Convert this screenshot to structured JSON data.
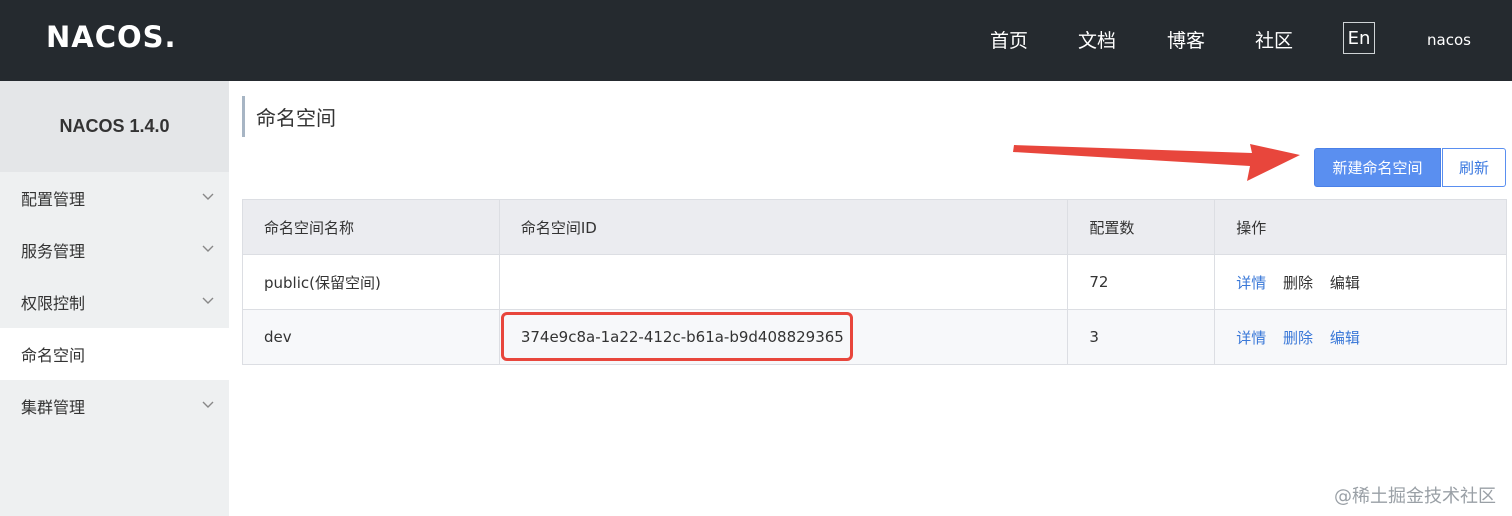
{
  "header": {
    "logo_text": "NACOS.",
    "nav": [
      "首页",
      "文档",
      "博客",
      "社区"
    ],
    "lang": "En",
    "user": "nacos"
  },
  "sidebar": {
    "title": "NACOS 1.4.0",
    "items": [
      {
        "label": "配置管理",
        "expandable": true
      },
      {
        "label": "服务管理",
        "expandable": true
      },
      {
        "label": "权限控制",
        "expandable": true
      },
      {
        "label": "命名空间",
        "expandable": false,
        "active": true
      },
      {
        "label": "集群管理",
        "expandable": true
      }
    ]
  },
  "page": {
    "title": "命名空间",
    "create_button": "新建命名空间",
    "refresh_button": "刷新"
  },
  "table": {
    "headers": [
      "命名空间名称",
      "命名空间ID",
      "配置数",
      "操作"
    ],
    "rows": [
      {
        "name": "public(保留空间)",
        "id": "",
        "count": "72",
        "actions": [
          "详情",
          "删除",
          "编辑"
        ]
      },
      {
        "name": "dev",
        "id": "374e9c8a-1a22-412c-b61a-b9d408829365",
        "count": "3",
        "actions": [
          "详情",
          "删除",
          "编辑"
        ]
      }
    ]
  },
  "watermark": "@稀土掘金技术社区",
  "colors": {
    "topbar": "#252a2f",
    "primary": "#5a8ff0",
    "highlight": "#e8463c"
  }
}
